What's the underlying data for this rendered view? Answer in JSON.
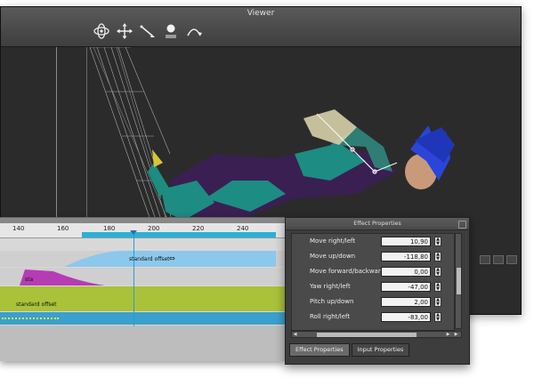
{
  "viewer": {
    "title": "Viewer",
    "tools": [
      "orbit-icon",
      "move-icon",
      "pick-icon",
      "light-icon",
      "arc-icon"
    ]
  },
  "timeline": {
    "ticks": [
      "140",
      "160",
      "180",
      "200",
      "220",
      "240"
    ],
    "tracks": [
      {
        "label": "standard offset",
        "color": "#8cc8ec"
      },
      {
        "label": "sta",
        "color": "#b63cb3"
      },
      {
        "label": "",
        "color": "#a9c23a"
      },
      {
        "label": "standard offset",
        "color": "#a9c23a"
      },
      {
        "label": "",
        "color": "#3aa0cc"
      }
    ]
  },
  "effect_properties": {
    "title": "Effect Properties",
    "rows": [
      {
        "label": "Move right/left",
        "value": "10,90"
      },
      {
        "label": "Move up/down",
        "value": "-118,80"
      },
      {
        "label": "Move forward/backward",
        "value": "0,00"
      },
      {
        "label": "Yaw right/left",
        "value": "-47,00"
      },
      {
        "label": "Pitch up/down",
        "value": "2,00"
      },
      {
        "label": "Roll right/left",
        "value": "-83,00"
      }
    ],
    "tabs": [
      "Effect Properties",
      "Input Properties"
    ]
  }
}
